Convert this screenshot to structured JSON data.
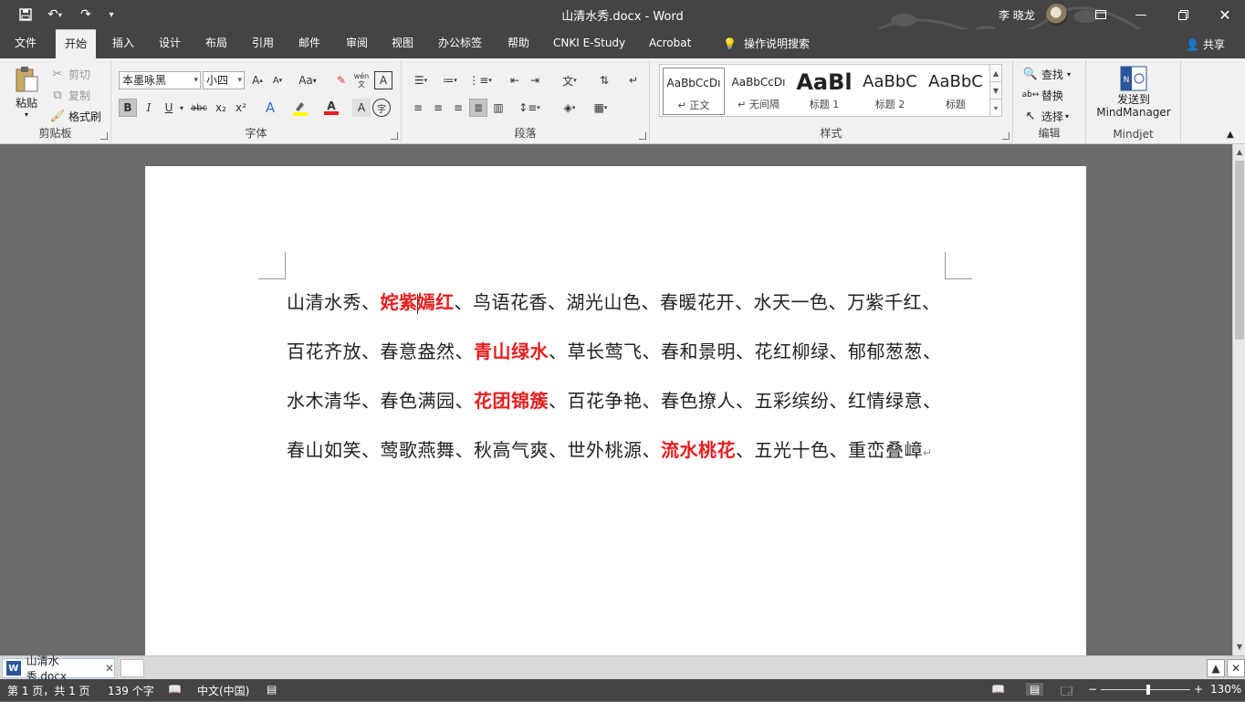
{
  "window": {
    "title": "山清水秀.docx  -  Word",
    "user": "李 晓龙"
  },
  "quick_access": {
    "save_icon": "save-icon",
    "undo_icon": "undo-icon",
    "redo_icon": "redo-icon",
    "customize_icon": "customize-icon"
  },
  "tabs": [
    {
      "label": "文件"
    },
    {
      "label": "开始"
    },
    {
      "label": "插入"
    },
    {
      "label": "设计"
    },
    {
      "label": "布局"
    },
    {
      "label": "引用"
    },
    {
      "label": "邮件"
    },
    {
      "label": "审阅"
    },
    {
      "label": "视图"
    },
    {
      "label": "办公标签"
    },
    {
      "label": "帮助"
    },
    {
      "label": "CNKI E-Study"
    },
    {
      "label": "Acrobat"
    },
    {
      "label": "操作说明搜索"
    }
  ],
  "share_label": "共享",
  "clipboard": {
    "group_label": "剪贴板",
    "paste": "粘贴",
    "cut": "剪切",
    "copy": "复制",
    "format_painter": "格式刷"
  },
  "font": {
    "group_label": "字体",
    "font_name": "本墨咏黑",
    "font_size": "小四",
    "change_case": "Aa",
    "phonetic": "wén",
    "bold": "B",
    "italic": "I",
    "underline": "U",
    "strike": "abc",
    "subscript": "x₂",
    "superscript": "x²",
    "text_effect": "A",
    "font_color": "A",
    "char_shading": "A",
    "enclose": "字"
  },
  "paragraph": {
    "group_label": "段落"
  },
  "styles": {
    "group_label": "样式",
    "items": [
      {
        "preview": "AaBbCcDı",
        "name": "↵ 正文"
      },
      {
        "preview": "AaBbCcDı",
        "name": "↵ 无间隔"
      },
      {
        "preview": "AaBl",
        "name": "标题 1"
      },
      {
        "preview": "AaBbC",
        "name": "标题 2"
      },
      {
        "preview": "AaBbC",
        "name": "标题"
      }
    ]
  },
  "editing": {
    "group_label": "编辑",
    "find": "查找",
    "replace": "替换",
    "select": "选择"
  },
  "mindjet": {
    "group_label": "Mindjet",
    "send_line1": "发送到",
    "send_line2": "MindManager"
  },
  "document": {
    "lines": [
      [
        {
          "t": "山清水秀、"
        },
        {
          "t": "姹紫",
          "red": true
        },
        {
          "caret": true
        },
        {
          "t": "嫣红",
          "red": true
        },
        {
          "t": "、鸟语花香、湖光山色、春暖花开、水天一色、万紫千红、"
        }
      ],
      [
        {
          "t": "百花齐放、春意盎然、"
        },
        {
          "t": "青山绿水",
          "red": true
        },
        {
          "t": "、草长莺飞、春和景明、花红柳绿、郁郁葱葱、"
        }
      ],
      [
        {
          "t": "水木清华、春色满园、"
        },
        {
          "t": "花团锦簇",
          "red": true
        },
        {
          "t": "、百花争艳、春色撩人、五彩缤纷、红情绿意、"
        }
      ],
      [
        {
          "t": "春山如笑、莺歌燕舞、秋高气爽、世外桃源、"
        },
        {
          "t": "流水桃花",
          "red": true
        },
        {
          "t": "、五光十色、重峦叠嶂"
        },
        {
          "t": "↵",
          "mark": true
        }
      ]
    ]
  },
  "doc_tabs": {
    "file_tab": "山清水秀.docx"
  },
  "status": {
    "page": "第 1 页，共 1 页",
    "words": "139 个字",
    "language": "中文(中国)",
    "zoom": "130%",
    "zoom_minus": "−",
    "zoom_plus": "+"
  },
  "colors": {
    "accent_red": "#e81d1d",
    "title_bar": "#444444",
    "word_blue": "#2b579a"
  }
}
